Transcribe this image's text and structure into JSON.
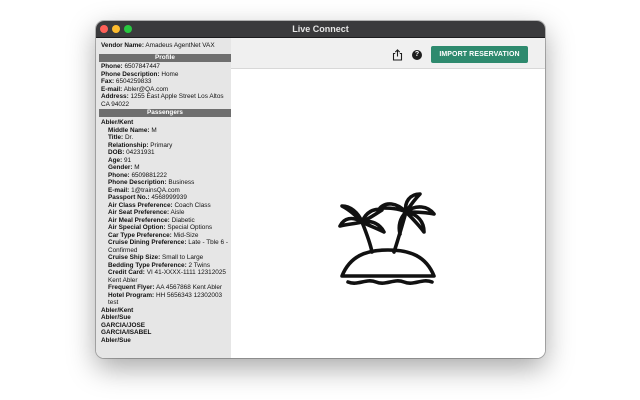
{
  "window": {
    "title": "Live Connect"
  },
  "vendor": {
    "label": "Vendor Name:",
    "value": "Amadeus AgentNet VAX"
  },
  "profile": {
    "header": "Profile",
    "phone": {
      "label": "Phone:",
      "value": "6507847447"
    },
    "phone_description": {
      "label": "Phone Description:",
      "value": "Home"
    },
    "fax": {
      "label": "Fax:",
      "value": "6504259833"
    },
    "email": {
      "label": "E-mail:",
      "value": "Abler@QA.com"
    },
    "address": {
      "label": "Address:",
      "value": "1255 East Apple Street Los Altos CA 94022"
    }
  },
  "passengers": {
    "header": "Passengers",
    "selected_name": "Abler/Kent",
    "details": [
      {
        "label": "Middle Name:",
        "value": "M"
      },
      {
        "label": "Title:",
        "value": "Dr."
      },
      {
        "label": "Relationship:",
        "value": "Primary"
      },
      {
        "label": "DOB:",
        "value": "04231931"
      },
      {
        "label": "Age:",
        "value": "91"
      },
      {
        "label": "Gender:",
        "value": "M"
      },
      {
        "label": "Phone:",
        "value": "6509881222"
      },
      {
        "label": "Phone Description:",
        "value": "Business"
      },
      {
        "label": "E-mail:",
        "value": "1@trainsQA.com"
      },
      {
        "label": "Passport No.:",
        "value": "4568999939"
      },
      {
        "label": "Air Class Preference:",
        "value": "Coach Class"
      },
      {
        "label": "Air Seat Preference:",
        "value": "Aisle"
      },
      {
        "label": "Air Meal Preference:",
        "value": "Diabetic"
      },
      {
        "label": "Air Special Option:",
        "value": "Special Options"
      },
      {
        "label": "Car Type Preference:",
        "value": "Mid-Size"
      },
      {
        "label": "Cruise Dining Preference:",
        "value": "Late - Tble 6 - Confirmed"
      },
      {
        "label": "Cruise Ship Size:",
        "value": "Small to Large"
      },
      {
        "label": "Bedding Type Preference:",
        "value": "2 Twins"
      },
      {
        "label": "Credit Card:",
        "value": "VI 41-XXXX-1111 12312025 Kent Abler"
      },
      {
        "label": "Frequent Flyer:",
        "value": "AA 4567868 Kent Abler"
      },
      {
        "label": "Hotel Program:",
        "value": "HH 5656343 12302003 test"
      }
    ],
    "others": [
      "Abler/Kent",
      "Abler/Sue",
      "GARCIA/JOSE",
      "GARCIA/ISABEL",
      "Abler/Sue"
    ]
  },
  "toolbar": {
    "share_icon": "share-icon",
    "help_icon": "help-icon",
    "help_glyph": "?",
    "import_label": "IMPORT RESERVATION",
    "import_color": "#2e8a6e"
  },
  "content": {
    "illustration": "island-palm-trees-icon"
  }
}
